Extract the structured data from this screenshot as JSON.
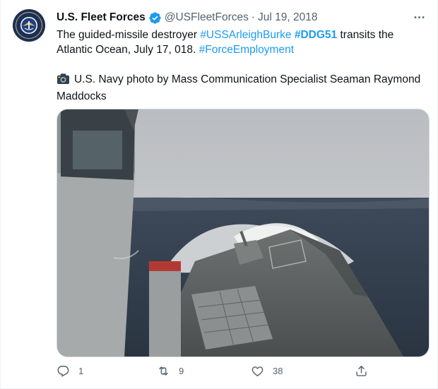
{
  "tweet": {
    "author": {
      "name": "U.S. Fleet Forces",
      "handle": "@USFleetForces",
      "verified": true
    },
    "separator": "·",
    "date": "Jul 19, 2018",
    "text": {
      "part1": "The guided-missile destroyer ",
      "hashtag1": "#USSArleighBurke",
      "space1": " ",
      "hashtag2": "#DDG51",
      "part2": " transits the Atlantic Ocean, July 17, 018. ",
      "hashtag3": "#ForceEmployment",
      "credit": "U.S. Navy photo by Mass Communication Specialist Seaman Raymond Maddocks"
    },
    "media": {
      "alt": "Guided-missile destroyer bow plunging through heavy seas with spray"
    },
    "metrics": {
      "replies": "1",
      "retweets": "9",
      "likes": "38"
    },
    "icons": [
      "verified-badge-icon",
      "more-icon",
      "camera-icon",
      "reply-icon",
      "retweet-icon",
      "like-icon",
      "share-icon"
    ],
    "colors": {
      "accent": "#1d9bf0",
      "secondary_text": "#536471",
      "primary_text": "#0f1419"
    }
  }
}
